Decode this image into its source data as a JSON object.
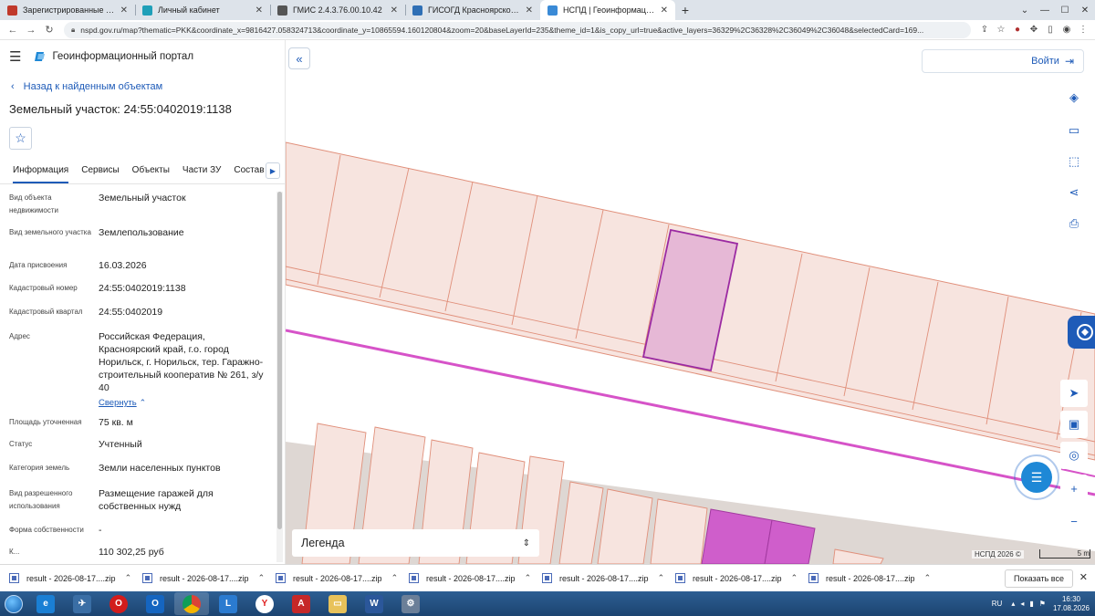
{
  "browser": {
    "tabs": [
      {
        "title": "Зарегистрированные сегодня",
        "color": "#c0392b",
        "active": false
      },
      {
        "title": "Личный кабинет",
        "color": "#1f9fb8",
        "active": false
      },
      {
        "title": "ГМИС 2.4.3.76.00.10.42",
        "color": "#555555",
        "active": false
      },
      {
        "title": "ГИСОГД Красноярского края",
        "color": "#2f6fb5",
        "active": false
      },
      {
        "title": "НСПД | Геоинформационный п",
        "color": "#3a8ad6",
        "active": true
      }
    ],
    "url": "nspd.gov.ru/map?thematic=PKK&coordinate_x=9816427.058324713&coordinate_y=10865594.160120804&zoom=20&baseLayerId=235&theme_id=1&is_copy_url=true&active_layers=36329%2C36328%2C36049%2C36048&selectedCard=169..."
  },
  "header": {
    "portal_name": "Геоинформационный портал",
    "back_label": "Назад к найденным объектам",
    "title": "Земельный участок: 24:55:0402019:1138"
  },
  "tabs": [
    "Информация",
    "Сервисы",
    "Объекты",
    "Части ЗУ",
    "Состав"
  ],
  "props": [
    {
      "k": "Вид объекта недвижимости",
      "v": "Земельный участок"
    },
    {
      "k": "Вид земельного участка",
      "v": "Землепользование"
    },
    {
      "k": "Дата присвоения",
      "v": "16.03.2026"
    },
    {
      "k": "Кадастровый номер",
      "v": "24:55:0402019:1138"
    },
    {
      "k": "Кадастровый квартал",
      "v": "24:55:0402019"
    },
    {
      "k": "Адрес",
      "v": "Российская Федерация, Красноярский край, г.о. город Норильск, г. Норильск, тер. Гаражно-строительный кооператив № 261, з/у 40"
    },
    {
      "k": "Площадь уточненная",
      "v": "75 кв. м"
    },
    {
      "k": "Статус",
      "v": "Учтенный"
    },
    {
      "k": "Категория земель",
      "v": "Земли населенных пунктов"
    },
    {
      "k": "Вид разрешенного использования",
      "v": "Размещение гаражей для собственных нужд"
    },
    {
      "k": "Форма собственности",
      "v": "-"
    },
    {
      "k": "К...",
      "v": "110 302,25 руб"
    }
  ],
  "collapse_link": "Свернуть",
  "map": {
    "login_label": "Войти",
    "legend_label": "Легенда",
    "attribution": "НСПД 2026 ©",
    "scale": "5 m"
  },
  "downloads": {
    "items": [
      "result - 2026-08-17....zip",
      "result - 2026-08-17....zip",
      "result - 2026-08-17....zip",
      "result - 2026-08-17....zip",
      "result - 2026-08-17....zip",
      "result - 2026-08-17....zip",
      "result - 2026-08-17....zip"
    ],
    "show_all": "Показать все"
  },
  "taskbar": {
    "lang": "RU",
    "time": "16:30",
    "date": "17.08.2026"
  }
}
